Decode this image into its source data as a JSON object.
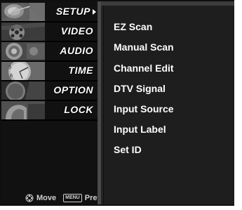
{
  "menu": {
    "items": [
      {
        "label": "SETUP",
        "active": true,
        "icon": "satellite-dish-icon"
      },
      {
        "label": "VIDEO",
        "active": false,
        "icon": "film-reel-icon"
      },
      {
        "label": "AUDIO",
        "active": false,
        "icon": "speaker-icon"
      },
      {
        "label": "TIME",
        "active": false,
        "icon": "clock-icon"
      },
      {
        "label": "OPTION",
        "active": false,
        "icon": "option-badge-icon"
      },
      {
        "label": "LOCK",
        "active": false,
        "icon": "lock-icon"
      }
    ]
  },
  "submenu": {
    "items": [
      {
        "label": "EZ Scan"
      },
      {
        "label": "Manual Scan"
      },
      {
        "label": "Channel Edit"
      },
      {
        "label": "DTV Signal"
      },
      {
        "label": "Input Source"
      },
      {
        "label": "Input Label"
      },
      {
        "label": "Set ID"
      }
    ]
  },
  "help": {
    "move_label": "Move",
    "prev_key": "MENU",
    "prev_label": "Prev"
  },
  "colors": {
    "menu_text": "#ffffff",
    "submenu_bg": "#1e1e1e",
    "screen_bg": "#0f0f0f"
  }
}
